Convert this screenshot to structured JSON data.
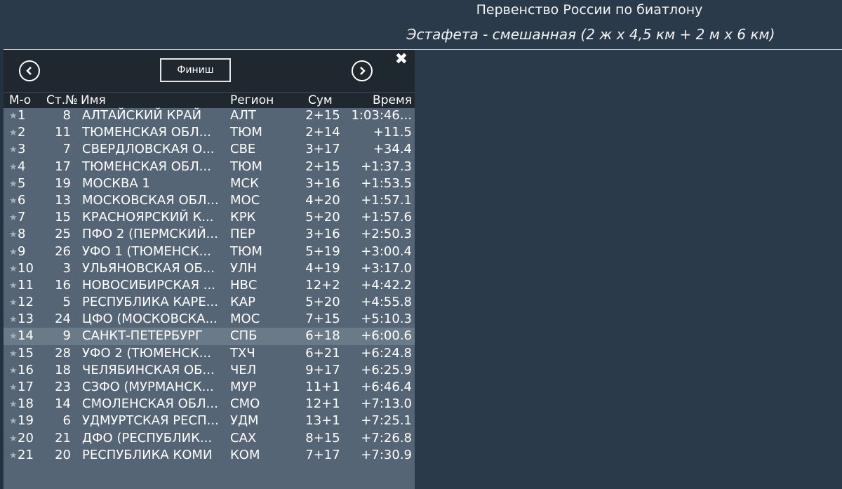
{
  "header": {
    "title": "Первенство России по биатлону",
    "subtitle": "Эстафета - смешанная (2 ж x 4,5 км + 2 м x 6 км)"
  },
  "controls": {
    "finish_label": "Финиш",
    "close_glyph": "✖",
    "prev_icon": "chevron-left-icon",
    "next_icon": "chevron-right-icon"
  },
  "columns": {
    "place": "М-о",
    "bib": "Ст.№",
    "name": "Имя",
    "region": "Регион",
    "sum": "Сум",
    "time": "Время"
  },
  "highlighted_row": 13,
  "rows": [
    {
      "place": "1",
      "bib": "8",
      "name": "АЛТАЙСКИЙ КРАЙ",
      "region": "АЛТ",
      "sum": "2+15",
      "time": "1:03:46..."
    },
    {
      "place": "2",
      "bib": "11",
      "name": "ТЮМЕНСКАЯ ОБЛ...",
      "region": "ТЮМ",
      "sum": "2+14",
      "time": "+11.5"
    },
    {
      "place": "3",
      "bib": "7",
      "name": "СВЕРДЛОВСКАЯ О...",
      "region": "СВЕ",
      "sum": "3+17",
      "time": "+34.4"
    },
    {
      "place": "4",
      "bib": "17",
      "name": "ТЮМЕНСКАЯ ОБЛ...",
      "region": "ТЮМ",
      "sum": "2+15",
      "time": "+1:37.3"
    },
    {
      "place": "5",
      "bib": "19",
      "name": "МОСКВА 1",
      "region": "МСК",
      "sum": "3+16",
      "time": "+1:53.5"
    },
    {
      "place": "6",
      "bib": "13",
      "name": "МОСКОВСКАЯ ОБЛ...",
      "region": "МОС",
      "sum": "4+20",
      "time": "+1:57.1"
    },
    {
      "place": "7",
      "bib": "15",
      "name": "КРАСНОЯРСКИЙ К...",
      "region": "КРК",
      "sum": "5+20",
      "time": "+1:57.6"
    },
    {
      "place": "8",
      "bib": "25",
      "name": "ПФО 2 (ПЕРМСКИЙ...",
      "region": "ПЕР",
      "sum": "3+16",
      "time": "+2:50.3"
    },
    {
      "place": "9",
      "bib": "26",
      "name": "УФО 1 (ТЮМЕНСК...",
      "region": "ТЮМ",
      "sum": "5+19",
      "time": "+3:00.4"
    },
    {
      "place": "10",
      "bib": "3",
      "name": "УЛЬЯНОВСКАЯ ОБ...",
      "region": "УЛН",
      "sum": "4+19",
      "time": "+3:17.0"
    },
    {
      "place": "11",
      "bib": "16",
      "name": "НОВОСИБИРСКАЯ ...",
      "region": "НВС",
      "sum": "12+2",
      "time": "+4:42.2"
    },
    {
      "place": "12",
      "bib": "5",
      "name": "РЕСПУБЛИКА КАРЕ...",
      "region": "КАР",
      "sum": "5+20",
      "time": "+4:55.8"
    },
    {
      "place": "13",
      "bib": "24",
      "name": "ЦФО (МОСКОВСКА...",
      "region": "МОС",
      "sum": "7+15",
      "time": "+5:10.3"
    },
    {
      "place": "14",
      "bib": "9",
      "name": "САНКТ-ПЕТЕРБУРГ",
      "region": "СПБ",
      "sum": "6+18",
      "time": "+6:00.6"
    },
    {
      "place": "15",
      "bib": "28",
      "name": "УФО 2 (ТЮМЕНСК...",
      "region": "ТХЧ",
      "sum": "6+21",
      "time": "+6:24.8"
    },
    {
      "place": "16",
      "bib": "18",
      "name": "ЧЕЛЯБИНСКАЯ ОБ...",
      "region": "ЧЕЛ",
      "sum": "9+17",
      "time": "+6:25.9"
    },
    {
      "place": "17",
      "bib": "23",
      "name": "СЗФО (МУРМАНСК...",
      "region": "МУР",
      "sum": "11+1",
      "time": "+6:46.4"
    },
    {
      "place": "18",
      "bib": "14",
      "name": "СМОЛЕНСКАЯ ОБЛ...",
      "region": "СМО",
      "sum": "12+1",
      "time": "+7:13.0"
    },
    {
      "place": "19",
      "bib": "6",
      "name": "УДМУРТСКАЯ РЕСП...",
      "region": "УДМ",
      "sum": "13+1",
      "time": "+7:25.1"
    },
    {
      "place": "20",
      "bib": "21",
      "name": "ДФО (РЕСПУБЛИК...",
      "region": "САХ",
      "sum": "8+15",
      "time": "+7:26.8"
    },
    {
      "place": "21",
      "bib": "20",
      "name": "РЕСПУБЛИКА КОМИ",
      "region": "КОМ",
      "sum": "7+17",
      "time": "+7:30.9"
    }
  ]
}
